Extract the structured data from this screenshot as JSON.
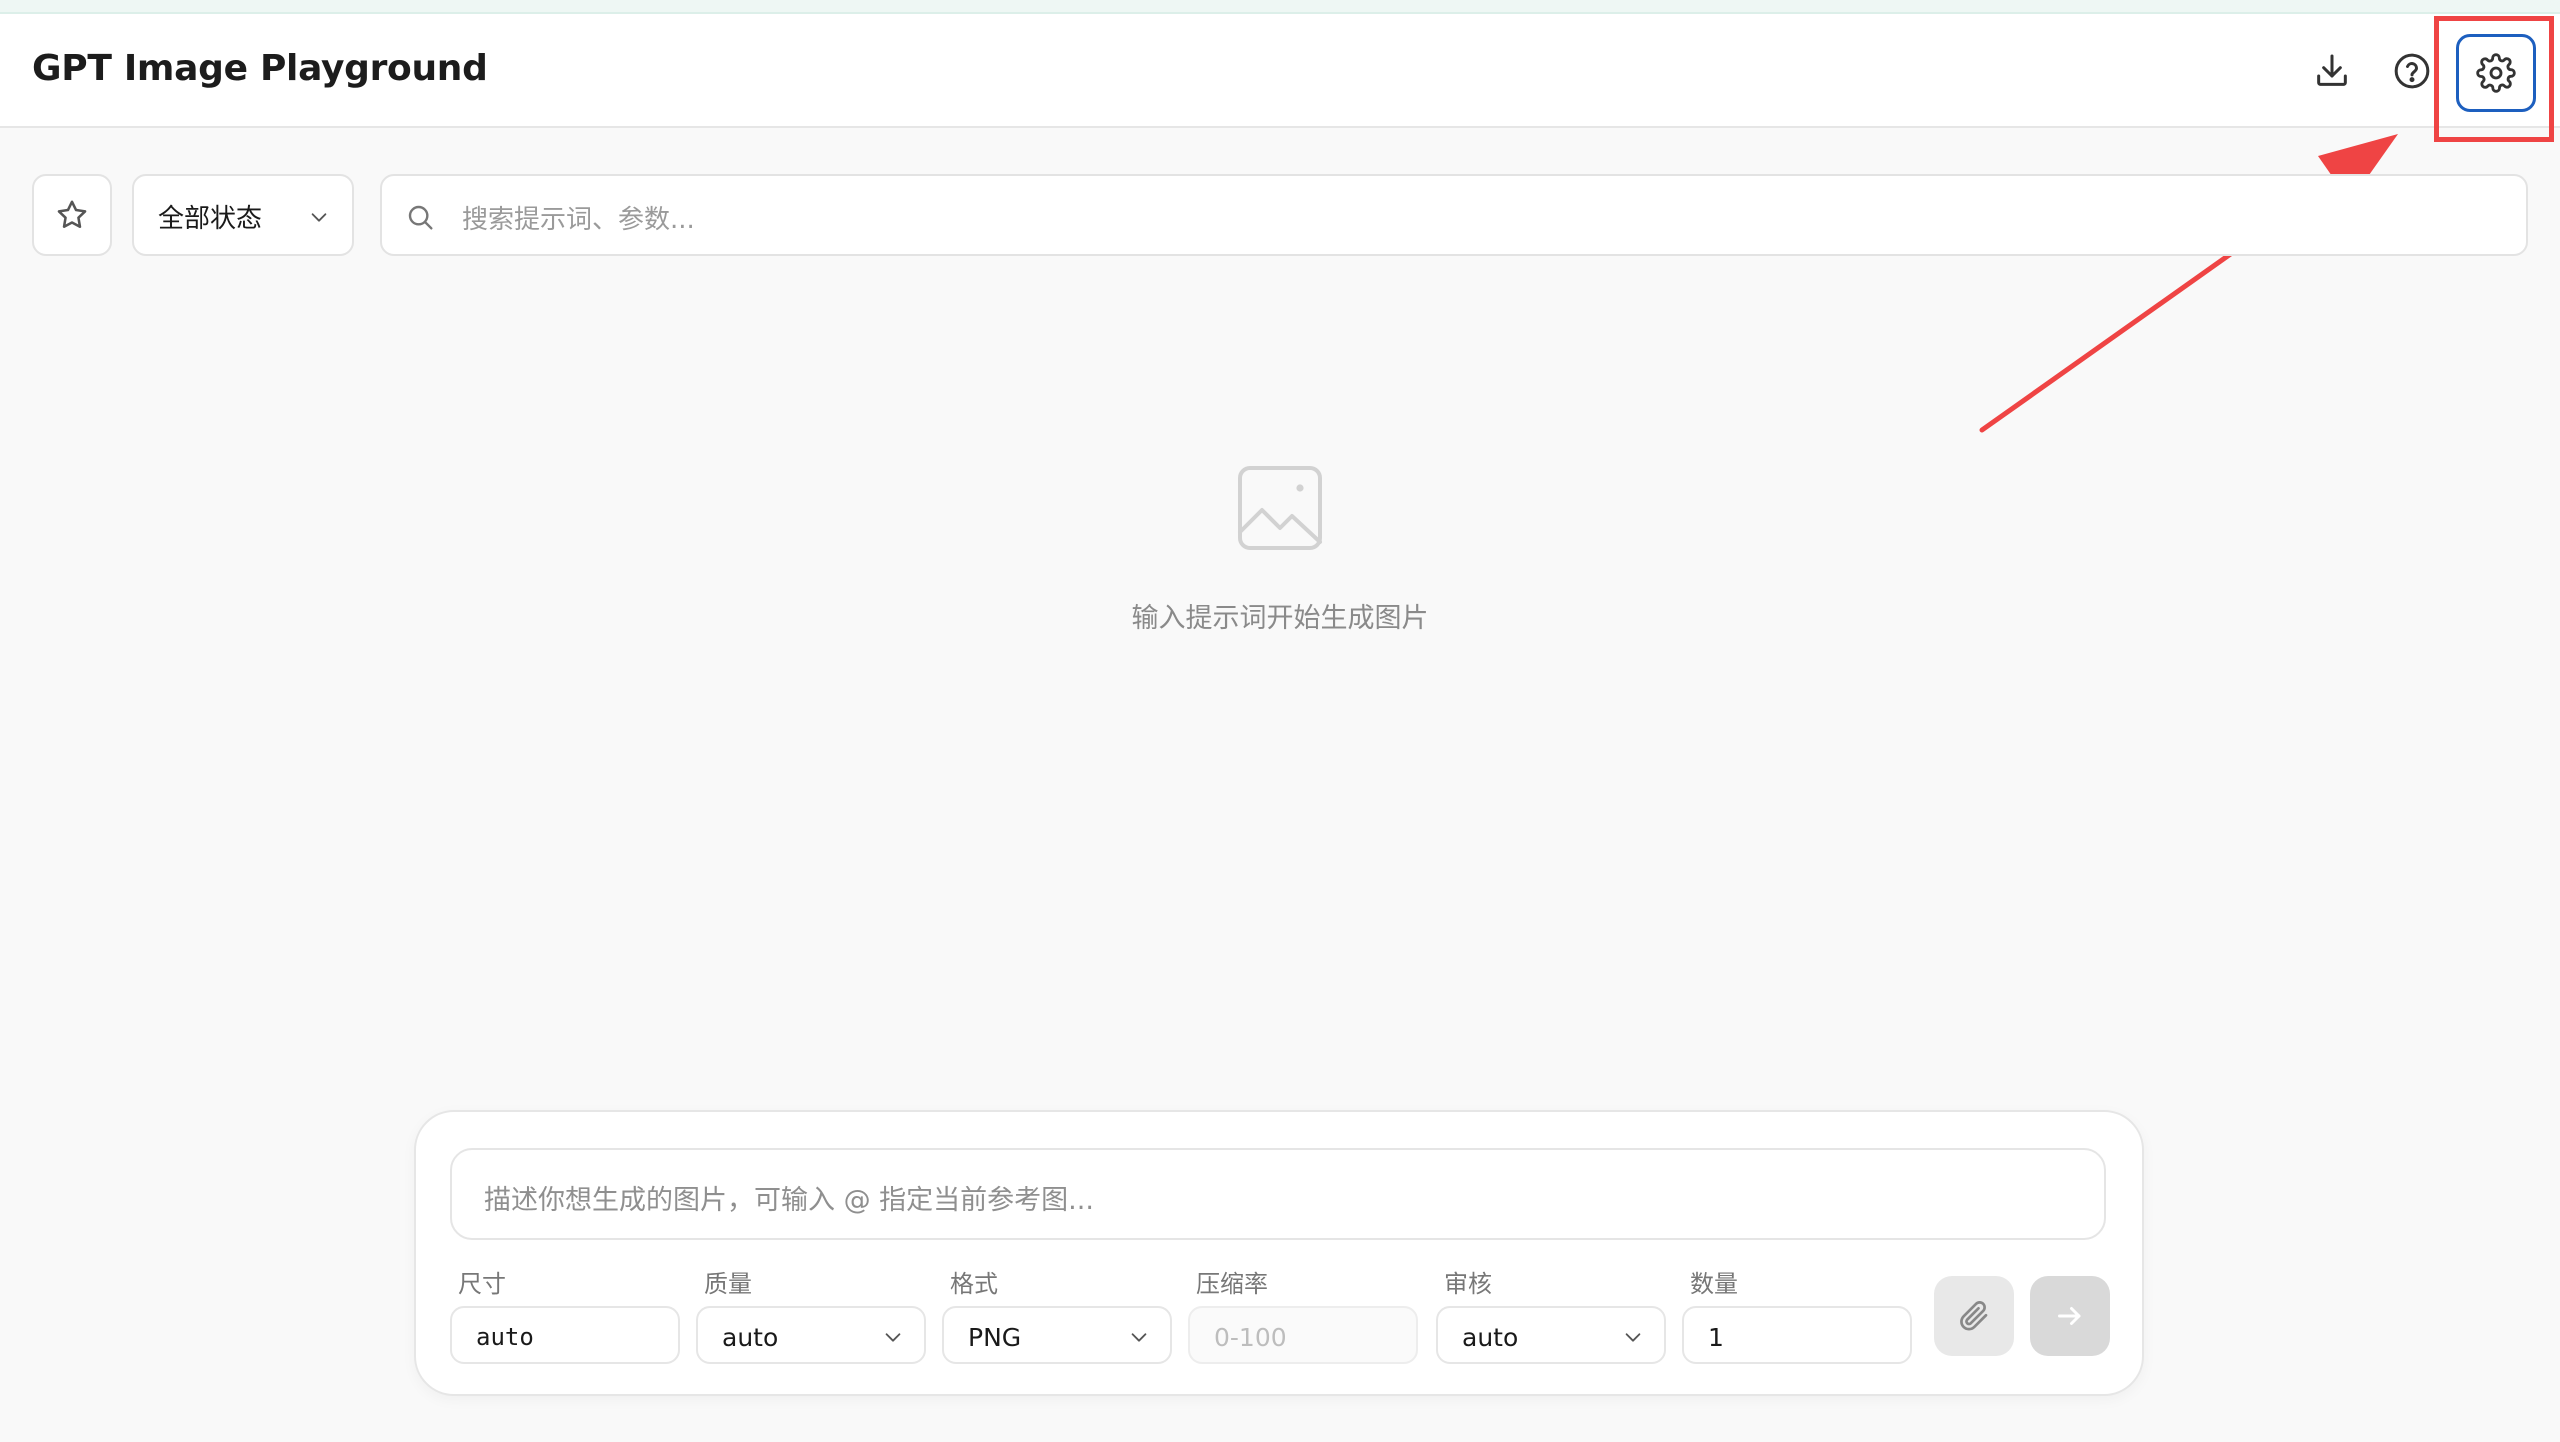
{
  "header": {
    "title": "GPT Image Playground",
    "icons": [
      "download-icon",
      "help-icon",
      "gear-icon"
    ]
  },
  "filters": {
    "favorite_icon": "star-icon",
    "status": "全部状态",
    "search_placeholder": "搜索提示词、参数..."
  },
  "empty_state": {
    "icon": "image-placeholder-icon",
    "message": "输入提示词开始生成图片"
  },
  "composer": {
    "prompt_placeholder": "描述你想生成的图片，可输入 @ 指定当前参考图...",
    "fields": {
      "size": {
        "label": "尺寸",
        "value": "auto"
      },
      "quality": {
        "label": "质量",
        "value": "auto"
      },
      "format": {
        "label": "格式",
        "value": "PNG"
      },
      "compression": {
        "label": "压缩率",
        "placeholder": "0-100"
      },
      "moderation": {
        "label": "审核",
        "value": "auto"
      },
      "count": {
        "label": "数量",
        "value": "1"
      }
    },
    "attach_icon": "paperclip-icon",
    "send_icon": "arrow-right-icon"
  },
  "annotation": {
    "highlight_color": "#ef4444",
    "accent_color": "#1d5fbf"
  }
}
